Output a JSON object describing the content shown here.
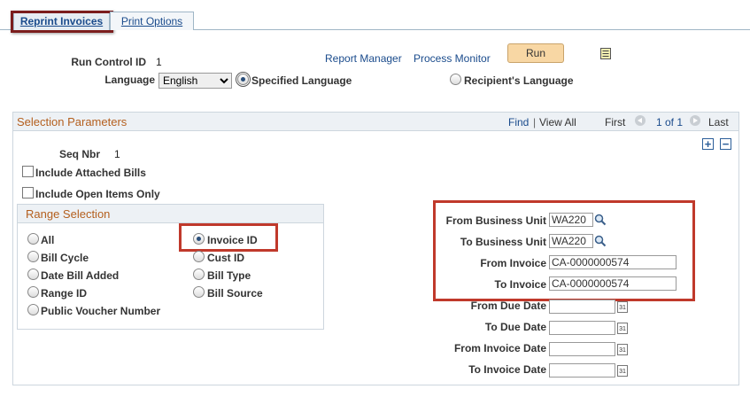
{
  "tabs": {
    "reprint_invoices": "Reprint Invoices",
    "print_options": "Print Options"
  },
  "header": {
    "run_control_label": "Run Control ID",
    "run_control_value": "1",
    "report_manager": "Report Manager",
    "process_monitor": "Process Monitor",
    "run_label": "Run",
    "language_label": "Language",
    "language_value": "English",
    "specified_language": "Specified Language",
    "recipient_language": "Recipient's Language"
  },
  "selection": {
    "title": "Selection Parameters",
    "find": "Find",
    "separator": "|",
    "view_all": "View All",
    "first": "First",
    "page_info": "1 of 1",
    "last": "Last",
    "seq_nbr_label": "Seq Nbr",
    "seq_nbr_value": "1",
    "include_attached_bills": "Include Attached Bills",
    "include_open_items": "Include Open Items Only",
    "add_symbol": "+",
    "remove_symbol": "−"
  },
  "range": {
    "title": "Range Selection",
    "all": "All",
    "bill_cycle": "Bill Cycle",
    "date_bill_added": "Date Bill Added",
    "range_id": "Range ID",
    "public_voucher": "Public Voucher Number",
    "invoice_id": "Invoice ID",
    "cust_id": "Cust ID",
    "bill_type": "Bill Type",
    "bill_source": "Bill Source"
  },
  "fields": {
    "from_bu_label": "From Business Unit",
    "from_bu_value": "WA220",
    "to_bu_label": "To Business Unit",
    "to_bu_value": "WA220",
    "from_invoice_label": "From Invoice",
    "from_invoice_value": "CA-0000000574",
    "to_invoice_label": "To Invoice",
    "to_invoice_value": "CA-0000000574",
    "from_due_label": "From Due Date",
    "to_due_label": "To Due Date",
    "from_inv_date_label": "From Invoice Date",
    "to_inv_date_label": "To Invoice Date",
    "calendar_glyph": "31"
  }
}
